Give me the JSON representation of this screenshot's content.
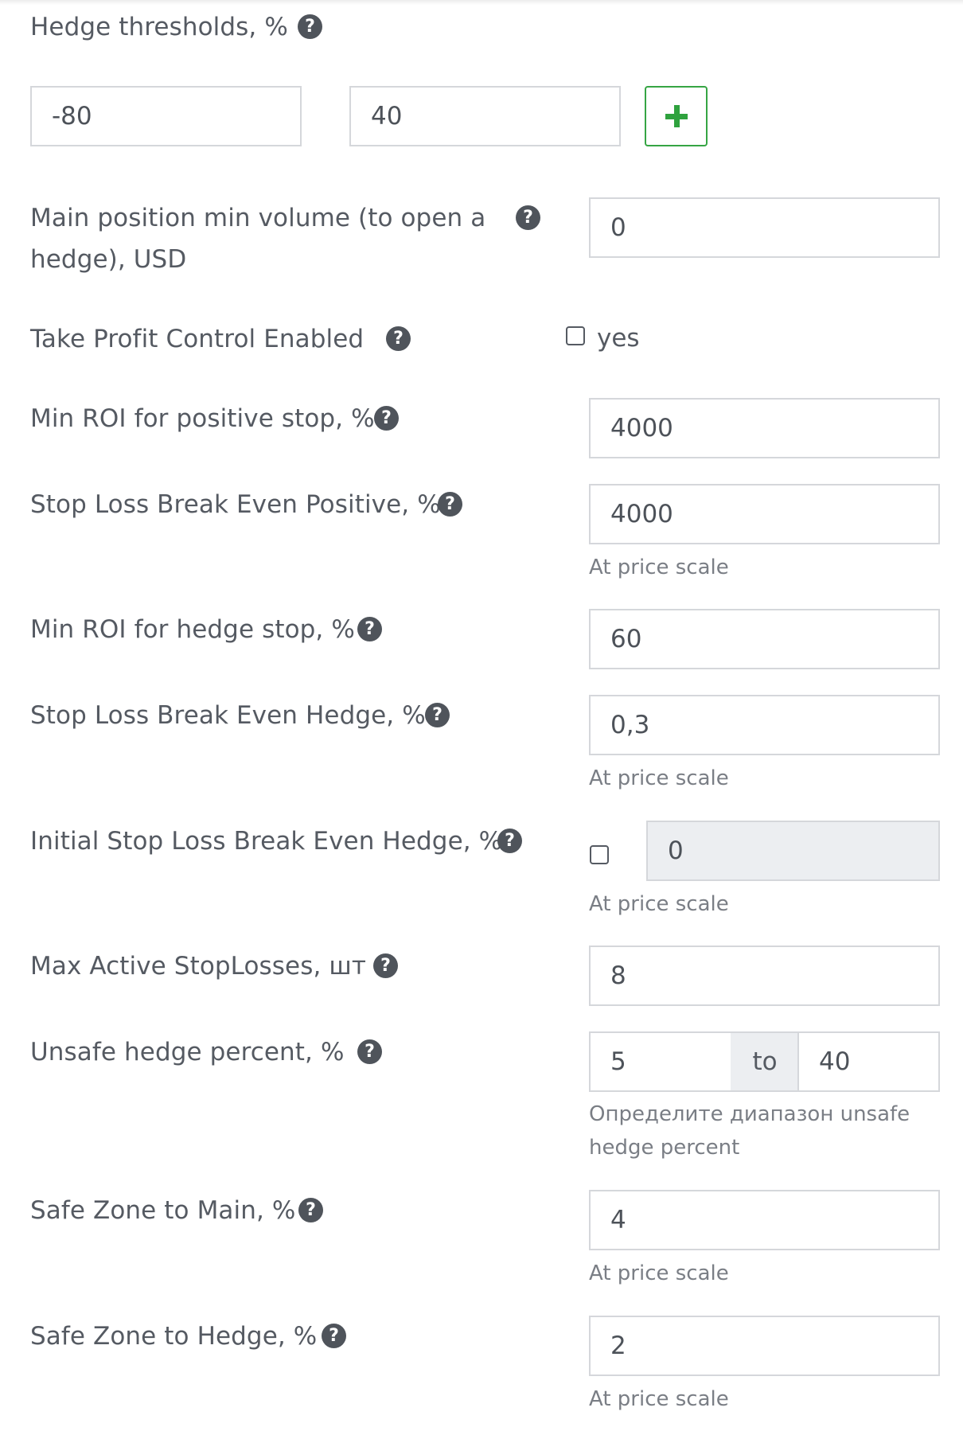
{
  "hedge_thresholds": {
    "label": "Hedge thresholds, %",
    "help_icon": "question-circle-icon",
    "min_value": "-80",
    "max_value": "40",
    "add_icon": "plus-icon"
  },
  "main_min_volume": {
    "label_line1": "Main position min volume (to open a",
    "label_line2": "hedge), USD",
    "value": "0"
  },
  "take_profit_control": {
    "label": "Take Profit Control Enabled",
    "checkbox_label": "yes",
    "checked": false
  },
  "min_roi_positive": {
    "label": "Min ROI for positive stop, %",
    "value": "4000"
  },
  "sl_break_even_positive": {
    "label": "Stop Loss Break Even Positive, %",
    "value": "4000",
    "hint": "At price scale"
  },
  "min_roi_hedge": {
    "label": "Min ROI for hedge stop, %",
    "value": "60"
  },
  "sl_break_even_hedge": {
    "label": "Stop Loss Break Even Hedge, %",
    "value": "0,3",
    "hint": "At price scale"
  },
  "initial_sl_break_even_hedge": {
    "label": "Initial Stop Loss Break Even Hedge, %",
    "checked": false,
    "value": "0",
    "hint": "At price scale"
  },
  "max_active_stoplosses": {
    "label": "Max Active StopLosses, шт",
    "value": "8"
  },
  "unsafe_hedge_percent": {
    "label": "Unsafe hedge percent, %",
    "from_value": "5",
    "to_label": "to",
    "to_value": "40",
    "hint_line1": "Определите диапазон unsafe",
    "hint_line2": "hedge percent"
  },
  "safe_zone_main": {
    "label": "Safe Zone to Main, %",
    "value": "4",
    "hint": "At price scale"
  },
  "safe_zone_hedge": {
    "label": "Safe Zone to Hedge, %",
    "value": "2",
    "hint": "At price scale"
  }
}
